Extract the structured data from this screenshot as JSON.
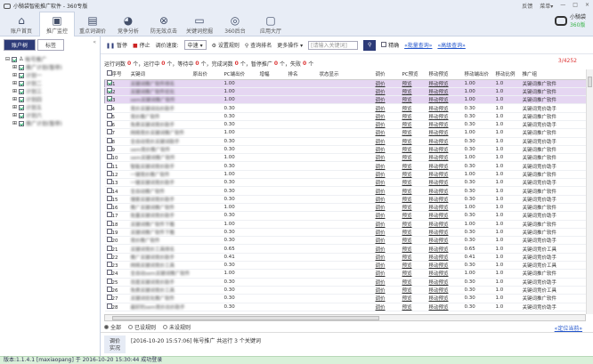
{
  "window": {
    "title": "小騎袋智能推广软件 - 360专版",
    "feedback": "反馈",
    "menu": "菜单▾",
    "min": "—",
    "max": "□",
    "close": "×"
  },
  "brand": {
    "line1": "小騎袋",
    "line2": "360版"
  },
  "nav": [
    {
      "label": "账户首页",
      "icon": "home-icon",
      "glyph": "⌂"
    },
    {
      "label": "推广监控",
      "icon": "monitor-icon",
      "glyph": "▣"
    },
    {
      "label": "重点词调价",
      "icon": "document-icon",
      "glyph": "▤"
    },
    {
      "label": "竞争分析",
      "icon": "pie-icon",
      "glyph": "◕"
    },
    {
      "label": "防无效点击",
      "icon": "block-icon",
      "glyph": "⊗"
    },
    {
      "label": "关键词挖掘",
      "icon": "terminal-icon",
      "glyph": "▭"
    },
    {
      "label": "360后台",
      "icon": "ring-icon",
      "glyph": "◎"
    },
    {
      "label": "应用大厅",
      "icon": "computer-icon",
      "glyph": "▢"
    }
  ],
  "sidebar": {
    "tabs": [
      "账户树",
      "标签"
    ],
    "collapse": "«",
    "root": "帐号推广",
    "items": [
      "推广计划(暂停)",
      "计划一",
      "计划二",
      "计划三",
      "计划四",
      "计划五",
      "计划六",
      "推广计划(暂停)"
    ]
  },
  "toolbar": {
    "pause": "暂停",
    "stop": "停止",
    "speed_label": "调价速度:",
    "speed_value": "中速",
    "settings": "设置规则",
    "query_rank": "查询排名",
    "more": "更多操作 ▾",
    "search_placeholder": "[请输入关键词]",
    "exact": "精确",
    "batch_query": "«批量查询»",
    "advanced_query": "«高级查询»"
  },
  "stats": {
    "l1": "运行词数",
    "v1": "0",
    "l2": "个，运行中",
    "v2": "0",
    "l3": "个，等待中",
    "v3": "0",
    "l4": "个，完成词数",
    "v4": "0",
    "l5": "个，暂停推广",
    "v5": "0",
    "l6": "个，失败",
    "v6": "0",
    "l7": "个",
    "ratio": "3/4252"
  },
  "columns": [
    "序号",
    "关键词",
    "原出价",
    "PC端出价",
    "增幅",
    "排名",
    "状态显示",
    "调价",
    "PC预览",
    "移动预览",
    "移动端出价",
    "移动比例",
    "推广组"
  ],
  "rows": [
    {
      "n": "1",
      "kw": "关键词推广软件排名",
      "bid": "1.00",
      "grp": "关键词推广软件",
      "sel": true
    },
    {
      "n": "2",
      "kw": "关键词推广软件优化",
      "bid": "1.00",
      "grp": "关键词推广软件",
      "sel": true
    },
    {
      "n": "3",
      "kw": "sem关键词推广软件",
      "bid": "1.00",
      "grp": "关键词推广软件",
      "sel": true
    },
    {
      "n": "4",
      "kw": "竞价关键词出价助手",
      "bid": "0.30",
      "grp": "关键词竞价助手"
    },
    {
      "n": "5",
      "kw": "竞价推广软件",
      "bid": "0.30",
      "grp": "关键词推广软件"
    },
    {
      "n": "6",
      "kw": "免费关键词竞价助手",
      "bid": "0.30",
      "grp": "关键词竞价助手"
    },
    {
      "n": "7",
      "kw": "网络竞价关键词推广软件",
      "bid": "1.00",
      "grp": "关键词推广软件"
    },
    {
      "n": "8",
      "kw": "全自动竞价关键词助手",
      "bid": "0.30",
      "grp": "关键词竞价助手"
    },
    {
      "n": "9",
      "kw": "sem竞价推广软件",
      "bid": "0.30",
      "grp": "关键词推广软件"
    },
    {
      "n": "10",
      "kw": "sem关键词推广软件",
      "bid": "1.00",
      "grp": "关键词推广软件"
    },
    {
      "n": "11",
      "kw": "智能关键词竞价助手",
      "bid": "0.30",
      "grp": "关键词竞价助手"
    },
    {
      "n": "12",
      "kw": "一键竞价推广软件",
      "bid": "1.00",
      "grp": "关键词推广软件"
    },
    {
      "n": "13",
      "kw": "一键关键词竞价助手",
      "bid": "0.30",
      "grp": "关键词竞价助手"
    },
    {
      "n": "14",
      "kw": "全自动推广软件",
      "bid": "0.30",
      "grp": "关键词推广软件"
    },
    {
      "n": "15",
      "kw": "搜索关键词竞价助手",
      "bid": "0.30",
      "grp": "关键词竞价助手"
    },
    {
      "n": "16",
      "kw": "推广关键词推广软件",
      "bid": "1.00",
      "grp": "关键词推广软件"
    },
    {
      "n": "17",
      "kw": "批量关键词竞价助手",
      "bid": "0.30",
      "grp": "关键词竞价助手"
    },
    {
      "n": "18",
      "kw": "关键词推广软件下载",
      "bid": "1.00",
      "grp": "关键词推广软件"
    },
    {
      "n": "19",
      "kw": "关键词推广软件下载",
      "bid": "0.30",
      "grp": "关键词推广软件"
    },
    {
      "n": "20",
      "kw": "竞价推广软件",
      "bid": "0.30",
      "grp": "关键词竞价助手"
    },
    {
      "n": "21",
      "kw": "关键词竞价工具排名",
      "bid": "0.65",
      "grp": "关键词竞价工具"
    },
    {
      "n": "22",
      "kw": "推广关键词竞价助手",
      "bid": "0.41",
      "grp": "关键词竞价助手"
    },
    {
      "n": "23",
      "kw": "网络关键词竞价工具",
      "bid": "0.30",
      "grp": "关键词竞价工具"
    },
    {
      "n": "24",
      "kw": "全自动sem关键词推广软件",
      "bid": "1.00",
      "grp": "关键词推广软件"
    },
    {
      "n": "25",
      "kw": "百度关键词竞价助手",
      "bid": "0.30",
      "grp": "关键词竞价助手"
    },
    {
      "n": "26",
      "kw": "免费关键词竞价工具",
      "bid": "0.30",
      "grp": "关键词竞价工具"
    },
    {
      "n": "27",
      "kw": "关键词优化推广软件",
      "bid": "0.30",
      "grp": "关键词推广软件"
    },
    {
      "n": "28",
      "kw": "最好的sem竞价出价助手",
      "bid": "0.30",
      "grp": "关键词竞价助手"
    }
  ],
  "row_links": {
    "adjust": "调价",
    "pc": "预览",
    "mobile": "移动预览",
    "ratio": "1.0"
  },
  "filters": {
    "all": "全部",
    "set": "已设规则",
    "unset": "未设规则",
    "locate": "«定位当前»"
  },
  "log": {
    "tag1": "调价",
    "tag2": "实况",
    "text": "[2016-10-20 15:57:06] 帐号推广 共运行 3 个关键词"
  },
  "statusbar": "版本:1.1.4.1 [maxiaopang] 于 2016-10-20 15:30:44 成功登录"
}
